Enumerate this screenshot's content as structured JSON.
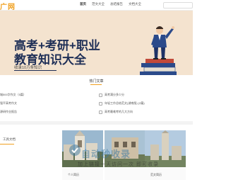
{
  "header": {
    "logo": "广网",
    "nav": [
      "首页",
      "范文大全",
      "总结报告",
      "文档大全"
    ]
  },
  "banner": {
    "title_line1": "高考+考研+职业",
    "title_line2": "教育知识大全",
    "subtitle": "收录10万条知识"
  },
  "hot": {
    "title": "热门文章",
    "left_items": [
      "城500字作文（5篇）",
      "强平高考作文",
      "源研作业报告"
    ],
    "right_items": [
      "高考满分多少分",
      "年轻工作总结范文(湖南版) (3篇)",
      "高考最难考的几大方向"
    ]
  },
  "bottom": {
    "left_link": "工具文档",
    "cards": [
      {
        "label": "个人简历"
      },
      {
        "label": ""
      },
      {
        "label": "范文简历"
      }
    ],
    "watermark_title": "自动秒收录",
    "watermark_sub": "加上链接一天访问一次 即可收录"
  },
  "colors": {
    "accent": "#f0a020",
    "banner_bg": "#f4e3cf",
    "title_color": "#1f2f57"
  }
}
